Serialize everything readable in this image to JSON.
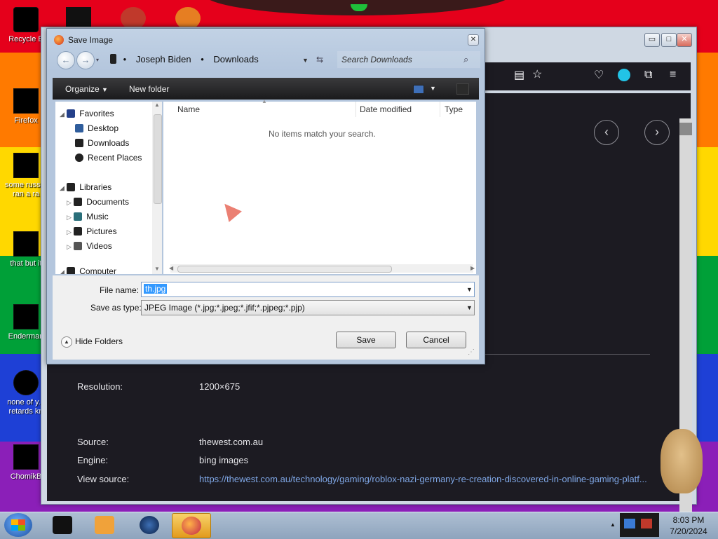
{
  "desktop": {
    "icons": [
      {
        "label": "Recycle B"
      },
      {
        "label": "Firefox"
      },
      {
        "label": "some russ... ran a ra"
      },
      {
        "label": "that but it"
      },
      {
        "label": "Enderman"
      },
      {
        "label": "none of y... retards kn"
      },
      {
        "label": "ChomikB"
      }
    ]
  },
  "browser": {
    "window_buttons": {
      "minimize": "▭",
      "maximize": "□",
      "close": "✕"
    },
    "image_info": {
      "resolution_label": "Resolution:",
      "resolution_value": "1200×675",
      "source_label": "Source:",
      "source_value": "thewest.com.au",
      "engine_label": "Engine:",
      "engine_value": "bing images",
      "view_source_label": "View source:",
      "view_source_value": "https://thewest.com.au/technology/gaming/roblox-nazi-germany-re-creation-discovered-in-online-gaming-platf..."
    }
  },
  "dialog": {
    "title": "Save Image",
    "close_label": "✕",
    "breadcrumb": [
      "Joseph Biden",
      "Downloads"
    ],
    "search_placeholder": "Search Downloads",
    "toolbar": {
      "organize": "Organize",
      "new_folder": "New folder"
    },
    "nav_tree": {
      "favorites": "Favorites",
      "favorites_items": [
        "Desktop",
        "Downloads",
        "Recent Places"
      ],
      "libraries": "Libraries",
      "libraries_items": [
        "Documents",
        "Music",
        "Pictures",
        "Videos"
      ],
      "computer": "Computer"
    },
    "columns": [
      "Name",
      "Date modified",
      "Type"
    ],
    "empty_message": "No items match your search.",
    "file_name_label": "File name:",
    "file_name_value": "th.jpg",
    "save_as_type_label": "Save as type:",
    "save_as_type_value": "JPEG Image (*.jpg;*.jpeg;*.jfif;*.pjpeg;*.pjp)",
    "hide_folders_label": "Hide Folders",
    "save_button": "Save",
    "cancel_button": "Cancel"
  },
  "taskbar": {
    "time": "8:03 PM",
    "date": "7/20/2024"
  },
  "colors": {
    "dialog_frame": "#b4c6dd",
    "command_bar": "#1a1a1c",
    "browser_bg": "#1c1b22",
    "link": "#7fa7e6",
    "selection": "#3399ff"
  }
}
